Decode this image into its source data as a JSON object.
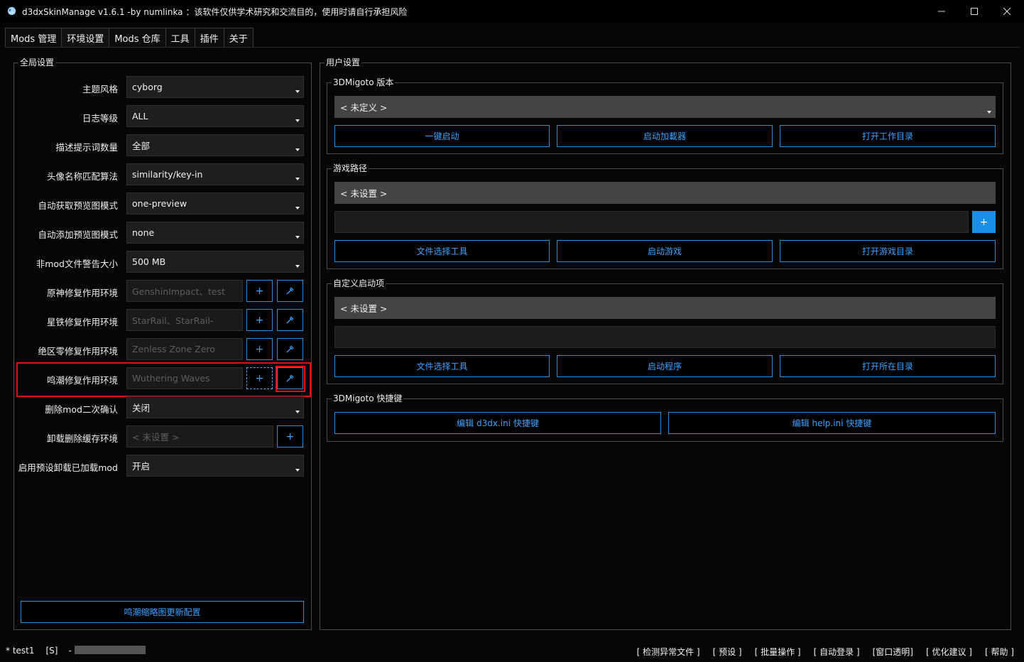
{
  "window": {
    "title": "d3dxSkinManage v1.6.1 -by numlinka ：该软件仅供学术研究和交流目的，使用时请自行承担风险"
  },
  "tabs": [
    {
      "label": "Mods 管理"
    },
    {
      "label": "环境设置"
    },
    {
      "label": "Mods 仓库"
    },
    {
      "label": "工具"
    },
    {
      "label": "插件"
    },
    {
      "label": "关于"
    }
  ],
  "global_settings": {
    "title": "全局设置",
    "theme": {
      "label": "主题风格",
      "value": "cyborg"
    },
    "log_level": {
      "label": "日志等级",
      "value": "ALL"
    },
    "prompt_count": {
      "label": "描述提示词数量",
      "value": "全部"
    },
    "avatar_match": {
      "label": "头像名称匹配算法",
      "value": "similarity/key-in"
    },
    "auto_preview_fetch": {
      "label": "自动获取预览图模式",
      "value": "one-preview"
    },
    "auto_preview_add": {
      "label": "自动添加预览图模式",
      "value": "none"
    },
    "nonmod_warn_size": {
      "label": "非mod文件警告大小",
      "value": "500 MB"
    },
    "genshin_env": {
      "label": "原神修复作用环境",
      "placeholder": "GenshinImpact、test",
      "add_label": "+"
    },
    "starrail_env": {
      "label": "星铁修复作用环境",
      "placeholder": "StarRail、StarRail-",
      "add_label": "+"
    },
    "zzz_env": {
      "label": "绝区零修复作用环境",
      "placeholder": "Zenless Zone Zero",
      "add_label": "+"
    },
    "wuwa_env": {
      "label": "鸣潮修复作用环境",
      "placeholder": "Wuthering Waves",
      "add_label": "+"
    },
    "delete_confirm": {
      "label": "删除mod二次确认",
      "value": "关闭"
    },
    "unload_cache_env": {
      "label": "卸载删除缓存环境",
      "placeholder": "< 未设置 >",
      "add_label": "+"
    },
    "preset_unload": {
      "label": "启用预设卸载已加载mod",
      "value": "开启"
    },
    "wuwa_update_button": "鸣潮缩略图更新配置"
  },
  "user_settings": {
    "title": "用户设置",
    "migoto_version": {
      "title": "3DMigoto 版本",
      "value": "< 未定义 >",
      "buttons": [
        "一键启动",
        "启动加載器",
        "打开工作目录"
      ]
    },
    "game_path": {
      "title": "游戏路径",
      "value": "< 未设置 >",
      "add_label": "+",
      "buttons": [
        "文件选择工具",
        "启动游戏",
        "打开游戏目录"
      ]
    },
    "custom_launch": {
      "title": "自定义启动项",
      "value": "< 未设置 >",
      "buttons": [
        "文件选择工具",
        "启动程序",
        "打开所在目录"
      ]
    },
    "hotkeys": {
      "title": "3DMigoto 快捷键",
      "buttons": [
        "编辑 d3dx.ini 快捷键",
        "编辑 help.ini 快捷键"
      ]
    }
  },
  "status": {
    "user": "* test1",
    "flag": "[S]",
    "sep": "-",
    "progress": 0,
    "actions": [
      "[ 检测异常文件 ]",
      "[ 预设 ]",
      "[ 批量操作 ]",
      "[ 自动登录 ]",
      "[窗口透明]",
      "[ 优化建议 ]",
      "[ 帮助 ]"
    ]
  },
  "colors": {
    "accent": "#2b8fd7",
    "highlight": "#e01010"
  }
}
